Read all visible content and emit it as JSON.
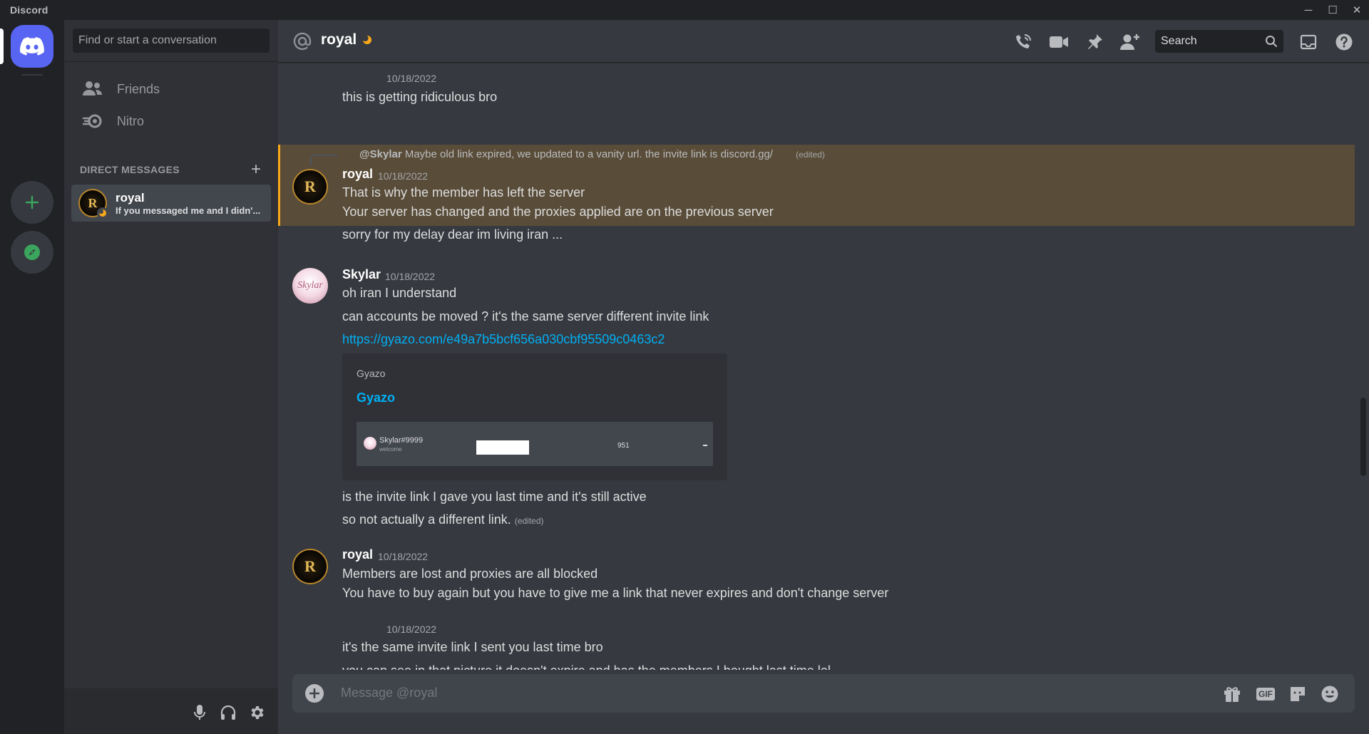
{
  "app": {
    "title": "Discord"
  },
  "window_controls": {
    "minimize": "─",
    "maximize": "☐",
    "close": "✕"
  },
  "sidebar": {
    "search_placeholder": "Find or start a conversation",
    "nav": [
      {
        "label": "Friends",
        "icon": "friends-icon"
      },
      {
        "label": "Nitro",
        "icon": "nitro-icon"
      }
    ],
    "dm_header": "DIRECT MESSAGES",
    "dm_add": "+",
    "dms": [
      {
        "name": "royal",
        "status": "If you messaged me and I didn'..."
      }
    ]
  },
  "header": {
    "channel_name": "royal",
    "search_placeholder": "Search"
  },
  "messages": {
    "g1": {
      "timestamp": "10/18/2022",
      "lines": [
        "this is getting ridiculous bro"
      ]
    },
    "g2": {
      "reply_author": "@Skylar",
      "reply_text": "Maybe old link expired, we updated to a vanity url. the invite link is discord.gg/",
      "reply_edited": "(edited)",
      "author": "royal",
      "timestamp": "10/18/2022",
      "lines": [
        "That is why the member has left the server",
        "Your server has changed and the proxies applied are on the previous server",
        "sorry for my delay dear im living iran  ..."
      ]
    },
    "g3": {
      "author": "Skylar",
      "timestamp": "10/18/2022",
      "lines": [
        "oh iran I understand",
        "can accounts be moved ? it's the same server different invite link"
      ],
      "link": "https://gyazo.com/e49a7b5bcf656a030cbf95509c0463c2",
      "embed": {
        "provider": "Gyazo",
        "title": "Gyazo",
        "thumb_user": "Skylar#9999",
        "thumb_sub": "welcome",
        "thumb_count": "951"
      },
      "after_lines": [
        "is the invite link I gave you last time and it's still active",
        "so not actually a different link."
      ],
      "edited": "(edited)"
    },
    "g4": {
      "author": "royal",
      "timestamp": "10/18/2022",
      "lines": [
        "Members are  lost and proxies are all blocked",
        "You have to buy again but you have to give me a link that never expires and don't change server"
      ]
    },
    "g5": {
      "timestamp": "10/18/2022",
      "lines": [
        "it's the same invite link I sent you last time bro",
        "you can see in that picture it doesn't expire and has the members I bought last time lol"
      ]
    }
  },
  "composer": {
    "placeholder": "Message @royal",
    "gif_label": "GIF"
  },
  "colors": {
    "blurple": "#5865f2",
    "green": "#3ba55d",
    "link": "#00aff4",
    "mention": "#faa81a",
    "idle_moon": "#faa81a"
  }
}
